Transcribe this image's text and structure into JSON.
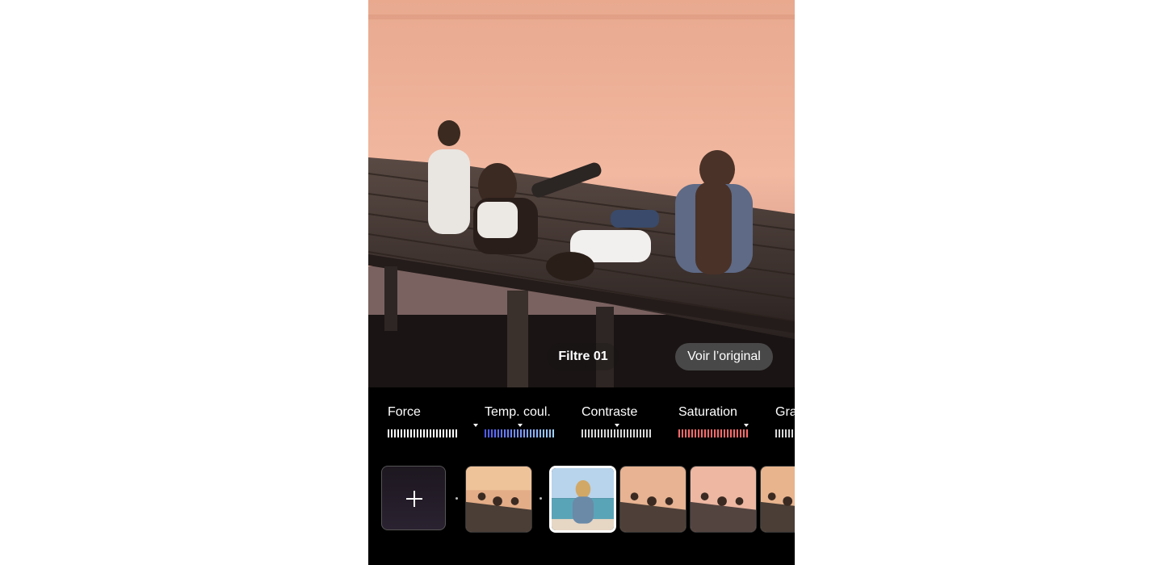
{
  "editor": {
    "filter_name": "Filtre 01",
    "view_original_label": "Voir l’original"
  },
  "adjustments": [
    {
      "label": "Force",
      "color": "#ffffff"
    },
    {
      "label": "Temp. coul.",
      "color": "#6a7cff"
    },
    {
      "label": "Contraste",
      "color": "#d8d8d8"
    },
    {
      "label": "Saturation",
      "color": "#ff6a6a"
    },
    {
      "label": "Gra",
      "color": "#d8d8d8"
    }
  ],
  "filters": {
    "add_icon": "plus-icon",
    "thumbnails": [
      {
        "name": "filter-thumb-1",
        "selected": false
      },
      {
        "name": "filter-thumb-custom",
        "selected": true
      },
      {
        "name": "filter-thumb-2",
        "selected": false
      },
      {
        "name": "filter-thumb-3",
        "selected": false
      },
      {
        "name": "filter-thumb-4",
        "selected": false
      }
    ]
  }
}
